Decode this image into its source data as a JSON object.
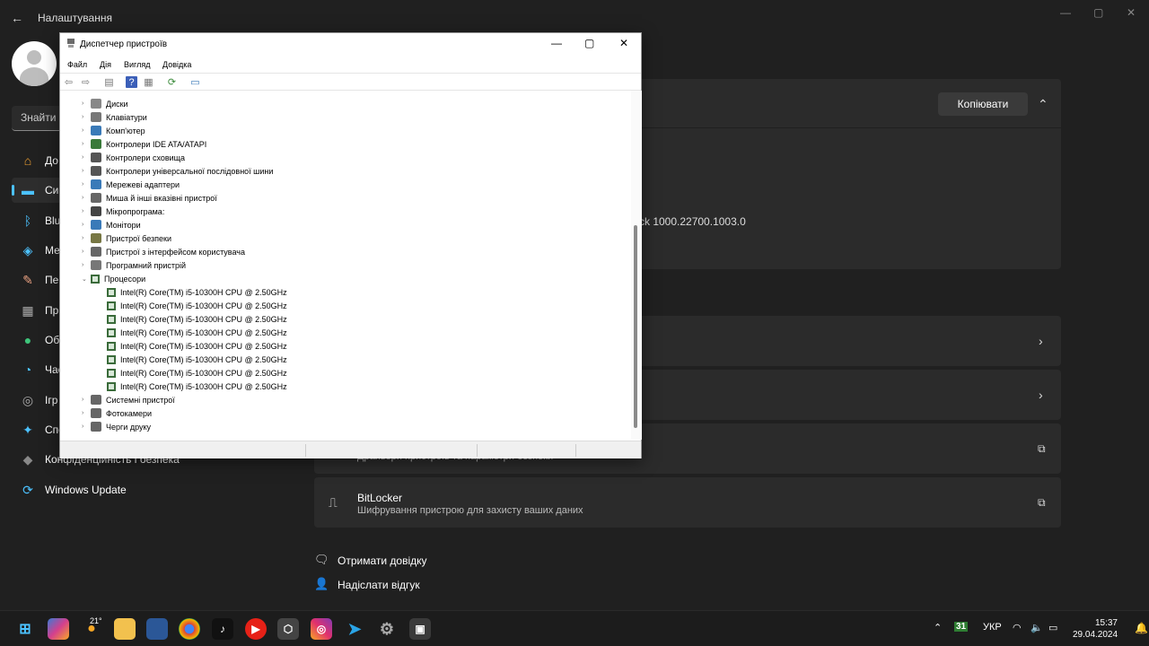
{
  "settings": {
    "title": "Налаштування",
    "search_placeholder": "Знайти п",
    "nav": [
      {
        "label": "До",
        "icon": "home-icon"
      },
      {
        "label": "Си",
        "icon": "system-icon"
      },
      {
        "label": "Blu",
        "icon": "bluetooth-icon"
      },
      {
        "label": "Ме",
        "icon": "network-icon"
      },
      {
        "label": "Пе",
        "icon": "personalization-icon"
      },
      {
        "label": "Пр",
        "icon": "apps-icon"
      },
      {
        "label": "Об",
        "icon": "accounts-icon"
      },
      {
        "label": "Час",
        "icon": "time-language-icon"
      },
      {
        "label": "Ігр",
        "icon": "gaming-icon"
      },
      {
        "label": "Спе",
        "icon": "accessibility-icon"
      },
      {
        "label": "Конфіденційність і безпека",
        "icon": "privacy-shield-icon"
      },
      {
        "label": "Windows Update",
        "icon": "windows-update-icon"
      }
    ],
    "copy_button": "Копіювати",
    "version_fragment": "ck 1000.22700.1003.0",
    "partial_desc": "Драйвери пристроїв та параметри безпеки",
    "bitlocker": {
      "title": "BitLocker",
      "desc": "Шифрування пристрою для захисту ваших даних"
    },
    "help": "Отримати довідку",
    "feedback": "Надіслати відгук"
  },
  "device_manager": {
    "title": "Диспетчер пристроїв",
    "menu": [
      "Файл",
      "Дія",
      "Вигляд",
      "Довідка"
    ],
    "categories_top": [
      "Диски",
      "Клавіатури",
      "Комп'ютер",
      "Контролери IDE ATA/ATAPI",
      "Контролери сховища",
      "Контролери універсальної послідовної шини",
      "Мережеві адаптери",
      "Миша й інші вказівні пристрої",
      "Мікропрограма:",
      "Монітори",
      "Пристрої безпеки",
      "Пристрої з інтерфейсом користувача",
      "Програмний пристрій"
    ],
    "expanded": "Процесори",
    "processors": [
      "Intel(R) Core(TM) i5-10300H CPU @ 2.50GHz",
      "Intel(R) Core(TM) i5-10300H CPU @ 2.50GHz",
      "Intel(R) Core(TM) i5-10300H CPU @ 2.50GHz",
      "Intel(R) Core(TM) i5-10300H CPU @ 2.50GHz",
      "Intel(R) Core(TM) i5-10300H CPU @ 2.50GHz",
      "Intel(R) Core(TM) i5-10300H CPU @ 2.50GHz",
      "Intel(R) Core(TM) i5-10300H CPU @ 2.50GHz",
      "Intel(R) Core(TM) i5-10300H CPU @ 2.50GHz"
    ],
    "categories_bottom": [
      "Системні пристрої",
      "Фотокамери",
      "Черги друку"
    ]
  },
  "taskbar": {
    "weather": "21°",
    "calendar_day": "31",
    "lang": "УКР",
    "time": "15:37",
    "date": "29.04.2024"
  }
}
